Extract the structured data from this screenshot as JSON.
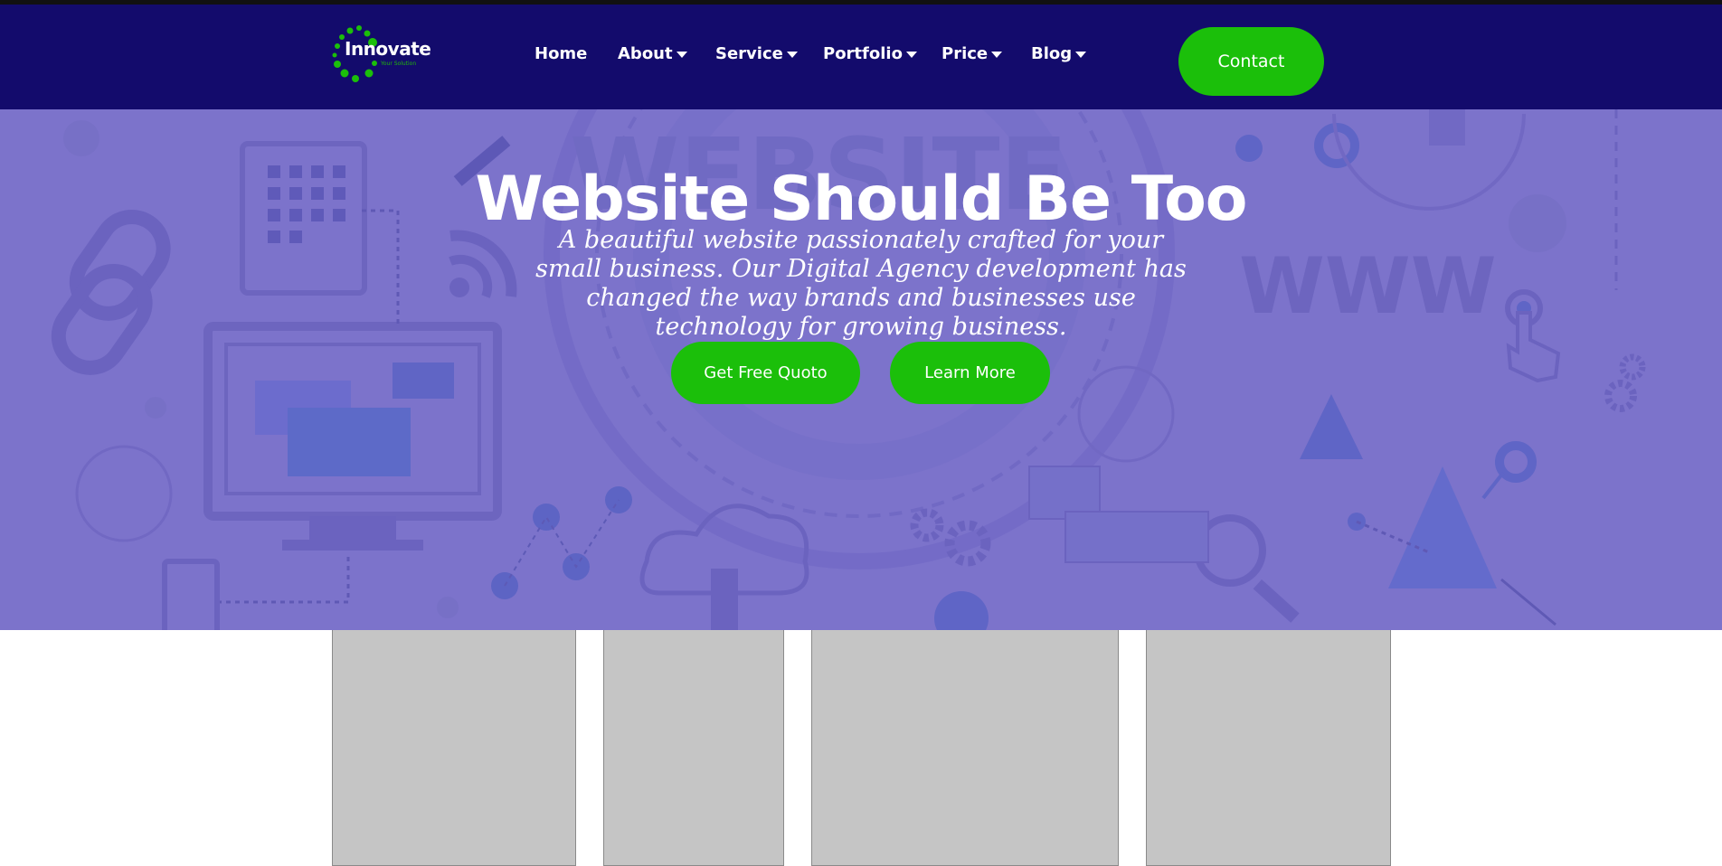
{
  "brand": {
    "name": "Innovate",
    "tagline": "Your Solution",
    "accent": "#1bbf0a",
    "nav_bg": "#130b6c",
    "hero_bg": "#7c73cb"
  },
  "nav": {
    "items": [
      {
        "label": "Home",
        "has_dropdown": false
      },
      {
        "label": "About",
        "has_dropdown": true
      },
      {
        "label": "Service",
        "has_dropdown": true
      },
      {
        "label": "Portfolio",
        "has_dropdown": true
      },
      {
        "label": "Price",
        "has_dropdown": true
      },
      {
        "label": "Blog",
        "has_dropdown": true
      }
    ],
    "contact_label": "Contact"
  },
  "hero": {
    "title": "Website Should Be Too",
    "subtitle": "A beautiful website passionately crafted for your small business. Our Digital Agency development has changed the way brands and businesses use technology for growing business.",
    "primary_button": "Get Free Quoto",
    "secondary_button": "Learn More",
    "background_words": [
      "WEBSITE",
      "WWW"
    ]
  },
  "cards": {
    "count": 4
  }
}
